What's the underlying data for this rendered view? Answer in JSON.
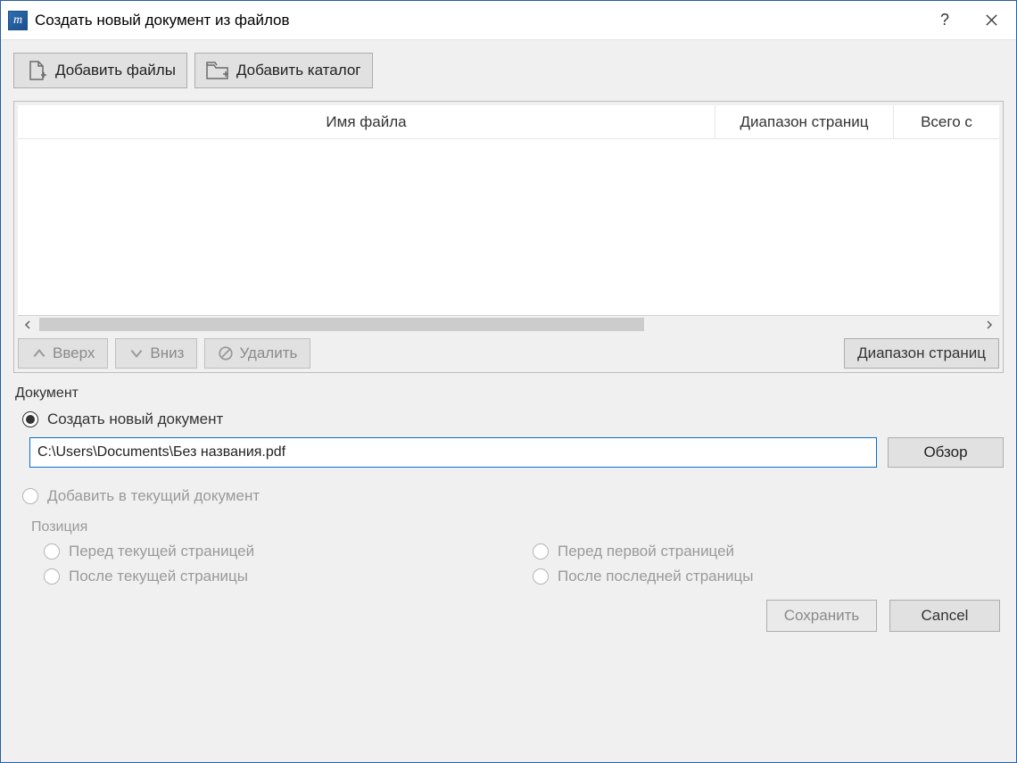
{
  "window": {
    "title": "Создать новый документ из файлов"
  },
  "toolbar": {
    "add_files": "Добавить файлы",
    "add_folder": "Добавить каталог"
  },
  "table": {
    "col_filename": "Имя файла",
    "col_range": "Диапазон страниц",
    "col_total": "Всего с"
  },
  "row_buttons": {
    "up": "Вверх",
    "down": "Вниз",
    "delete": "Удалить",
    "page_range": "Диапазон страниц"
  },
  "document": {
    "section_label": "Документ",
    "create_new": "Создать новый документ",
    "path": "C:\\Users\\Documents\\Без названия.pdf",
    "browse": "Обзор",
    "add_to_current": "Добавить в текущий документ"
  },
  "position": {
    "section_label": "Позиция",
    "before_current": "Перед текущей страницей",
    "after_current": "После текущей страницы",
    "before_first": "Перед первой страницей",
    "after_last": "После последней страницы"
  },
  "footer": {
    "save": "Сохранить",
    "cancel": "Cancel"
  }
}
